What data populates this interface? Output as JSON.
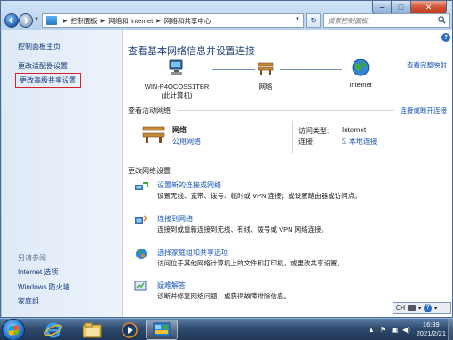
{
  "window": {
    "caption": {
      "minimize": "–",
      "maximize": "□",
      "close": "✕"
    }
  },
  "navbar": {
    "back_icon": "arrow-left-icon",
    "forward_icon": "arrow-right-icon",
    "breadcrumb": [
      "控制面板",
      "网络和 Internet",
      "网络和共享中心"
    ],
    "refresh_glyph": "↻",
    "search_placeholder": "搜索控制面板"
  },
  "sidebar": {
    "top_links": [
      "控制面板主页",
      "更改适配器设置",
      "更改高级共享设置"
    ],
    "see_also_heading": "另请参阅",
    "see_also_links": [
      "Internet 选项",
      "Windows 防火墙",
      "家庭组"
    ]
  },
  "main": {
    "help_glyph": "?",
    "title": "查看基本网络信息并设置连接",
    "view_full_map": "查看完整映射",
    "map": {
      "computer_name": "WIN-P4OCOSS1TBR",
      "computer_sub": "(此计算机)",
      "network_label": "网络",
      "internet_label": "Internet"
    },
    "active_networks_heading": "查看活动网络",
    "connect_disconnect": "连接或断开连接",
    "active_network": {
      "name": "网络",
      "type": "公用网络",
      "access_type_label": "访问类型:",
      "access_type_value": "Internet",
      "connections_label": "连接:",
      "connections_value": "本地连接"
    },
    "change_settings_heading": "更改网络设置",
    "tasks": [
      {
        "title": "设置新的连接或网络",
        "desc": "设置无线、宽带、拨号、临时或 VPN 连接；或设置路由器或访问点。",
        "icon": "network-setup-icon"
      },
      {
        "title": "连接到网络",
        "desc": "连接到或重新连接到无线、有线、拨号或 VPN 网络连接。",
        "icon": "connect-network-icon"
      },
      {
        "title": "选择家庭组和共享选项",
        "desc": "访问位于其他网络计算机上的文件和打印机，或更改共享设置。",
        "icon": "homegroup-icon"
      },
      {
        "title": "疑难解答",
        "desc": "诊断并修复网络问题，或获得故障排除信息。",
        "icon": "troubleshoot-icon"
      }
    ]
  },
  "langbar": {
    "lang": "CH",
    "help": "?"
  },
  "taskbar": {
    "pinned": [
      "internet-explorer-icon",
      "explorer-folder-icon",
      "media-player-icon",
      "control-panel-icon"
    ],
    "clock_time": "16:39",
    "clock_date": "2021/2/21",
    "tray": {
      "expand": "▲",
      "flag": "flag-icon",
      "network": "network-icon",
      "volume": "volume-icon"
    }
  },
  "colors": {
    "accent": "#1a56b5",
    "title": "#1f3f7a",
    "highlight_box": "#d6202a"
  }
}
